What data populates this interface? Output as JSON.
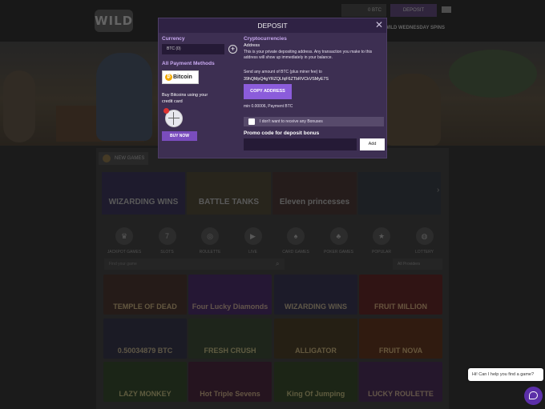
{
  "site": {
    "logo_text": "WILD",
    "balance": "0 BTC",
    "deposit_button": "DEPOSIT",
    "promo_tab": "WILD WEDNESDAY SPINS"
  },
  "new_games_tab": "NEW GAMES",
  "game_strip": [
    {
      "title": "WIZARDING WINS",
      "color": "#2e2a46"
    },
    {
      "title": "BATTLE TANKS",
      "color": "#3e3a2c"
    },
    {
      "title": "Eleven princesses",
      "color": "#3a2c2a"
    },
    {
      "title": "",
      "color": "#2c3036"
    }
  ],
  "categories": [
    {
      "label": "JACKPOT GAMES",
      "icon": "trophy-icon"
    },
    {
      "label": "SLOTS",
      "icon": "slot-icon"
    },
    {
      "label": "ROULETTE",
      "icon": "roulette-icon"
    },
    {
      "label": "LIVE",
      "icon": "live-icon"
    },
    {
      "label": "CARD GAMES",
      "icon": "cards-icon"
    },
    {
      "label": "POKER GAMES",
      "icon": "poker-icon"
    },
    {
      "label": "POPULAR",
      "icon": "popular-icon"
    },
    {
      "label": "LOTTERY",
      "icon": "lottery-icon"
    }
  ],
  "search_placeholder": "Find your game",
  "provider_select": "All Providers",
  "games_grid": [
    {
      "title": "TEMPLE OF DEAD",
      "color": "#3a2a26"
    },
    {
      "title": "Four Lucky Diamonds",
      "color": "#3a2450"
    },
    {
      "title": "WIZARDING WINS",
      "color": "#2c2a40"
    },
    {
      "title": "FRUIT MILLION",
      "color": "#4a2020"
    },
    {
      "title": "0.50034879 BTC",
      "color": "#2a2a3a"
    },
    {
      "title": "FRESH CRUSH",
      "color": "#2e3a2a"
    },
    {
      "title": "ALLIGATOR",
      "color": "#3a3020"
    },
    {
      "title": "FRUIT NOVA",
      "color": "#4a2a1a"
    },
    {
      "title": "LAZY MONKEY",
      "color": "#2a3a24"
    },
    {
      "title": "Hot Triple Sevens",
      "color": "#3a2030"
    },
    {
      "title": "King Of Jumping",
      "color": "#2c3a22"
    },
    {
      "title": "LUCKY ROULETTE",
      "color": "#3a2444"
    }
  ],
  "deposit_modal": {
    "title": "DEPOSIT",
    "currency_label": "Currency",
    "currency_value": "BTC (0)",
    "all_methods_label": "All Payment Methods",
    "bitcoin_label": "Bitcoin",
    "buy_bitcoins_text": "Buy Bitcoins using your credit card",
    "buy_now": "BUY NOW",
    "crypto_label": "Cryptocurrencies",
    "address_label": "Address",
    "address_info": "This is your private depositing address. Any transaction you make to this address will show up immediately in your balance.",
    "send_text": "Send any amount of BTC (plus miner fee) to",
    "address": "39hQMpQ4gYRZQLfqF6ZTbRVCkVSMyE7S",
    "copy_button": "COPY ADDRESS",
    "min_text": "min 0.00006, Payment BTC",
    "no_bonus_label": "I don't want to receive any Bonuses",
    "promo_label": "Promo code for deposit bonus",
    "add_button": "Add"
  },
  "chat": {
    "greeting": "Hi! Can I help you find a game?"
  },
  "colors": {
    "modal_bg": "#3d2f52",
    "accent_purple": "#8b5cdb",
    "label_purple": "#c8a8f0",
    "bitcoin_orange": "#f2a900"
  }
}
